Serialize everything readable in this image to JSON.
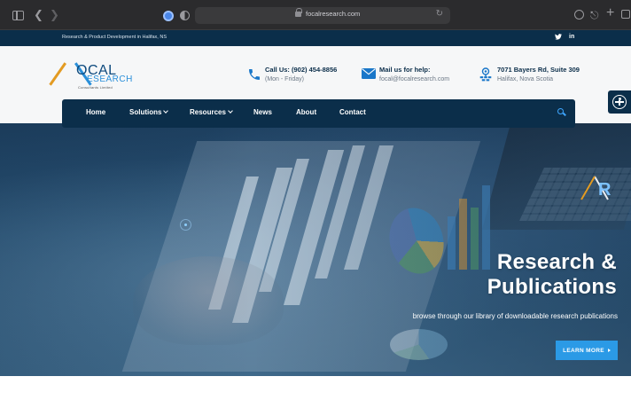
{
  "browser": {
    "url": "focalresearch.com"
  },
  "topbar": {
    "tagline": "Research & Product Development in Halifax, NS",
    "social": [
      "twitter-icon",
      "linkedin-icon"
    ],
    "twitter_glyph": "🐦",
    "linkedin_label": "in"
  },
  "logo": {
    "line1": "OCAL",
    "line2": "ESEARCH",
    "line3": "Consultants Limited"
  },
  "contacts": [
    {
      "icon": "phone-icon",
      "title": "Call Us: (902) 454-8856",
      "subtitle": "(Mon - Friday)"
    },
    {
      "icon": "mail-icon",
      "title": "Mail us for help:",
      "subtitle": "focal@focalresearch.com"
    },
    {
      "icon": "location-icon",
      "title": "7071 Bayers Rd, Suite 309",
      "subtitle": "Halifax, Nova Scotia"
    }
  ],
  "nav": {
    "items": [
      {
        "label": "Home",
        "dropdown": false
      },
      {
        "label": "Solutions",
        "dropdown": true
      },
      {
        "label": "Resources",
        "dropdown": true
      },
      {
        "label": "News",
        "dropdown": false
      },
      {
        "label": "About",
        "dropdown": false
      },
      {
        "label": "Contact",
        "dropdown": false
      }
    ]
  },
  "hero": {
    "title_line1": "Research &",
    "title_line2": "Publications",
    "subtitle": "browse through our library of downloadable research publications",
    "cta": "LEARN MORE"
  },
  "colors": {
    "navy": "#0b2e4a",
    "accent_blue": "#2b9ae6",
    "logo_orange": "#e39b22"
  }
}
